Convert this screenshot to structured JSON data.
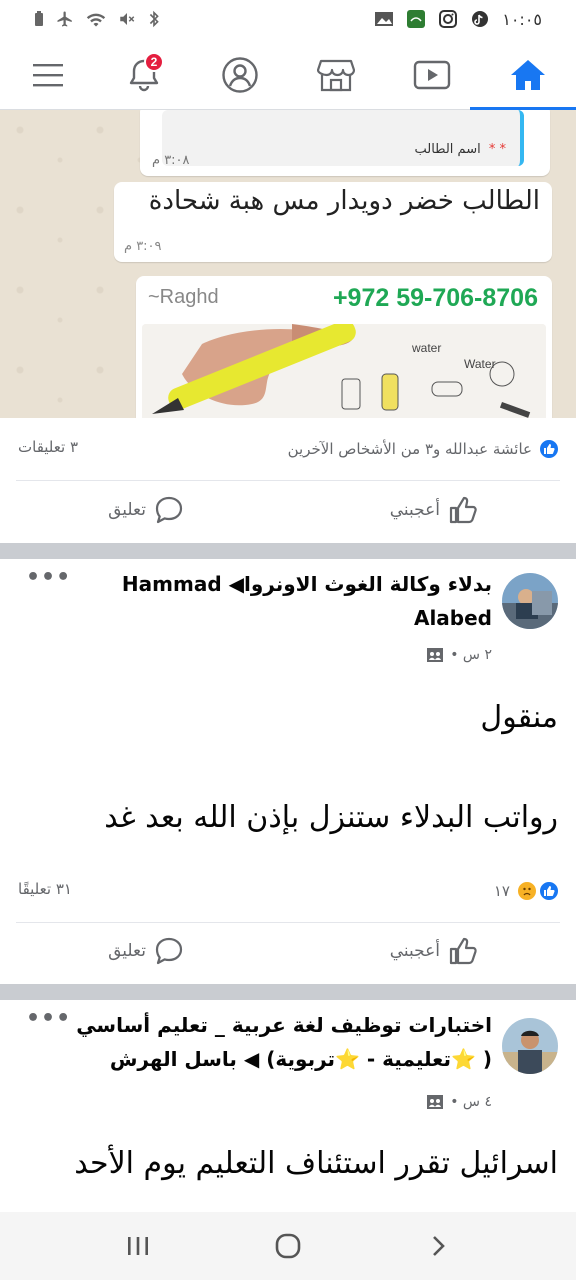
{
  "status_bar": {
    "time": "١٠:٠٥"
  },
  "nav": {
    "items": [
      {
        "name": "menu",
        "icon": "hamburger-menu-icon"
      },
      {
        "name": "notifications",
        "icon": "bell-icon",
        "badge": "2"
      },
      {
        "name": "profile",
        "icon": "profile-icon"
      },
      {
        "name": "marketplace",
        "icon": "store-icon"
      },
      {
        "name": "watch",
        "icon": "video-icon"
      },
      {
        "name": "home",
        "icon": "home-icon",
        "active": true
      }
    ],
    "accent": "#1877f2",
    "badge_color": "#e41e3f"
  },
  "shared_image": {
    "quoted_label": "اسم الطالب",
    "quoted_star": "* *",
    "time_1": "٣:٠٨ م",
    "message": "الطالب خضر دويدار  مس هبة  شحادة",
    "time_2": "٣:٠٩ م",
    "sender": "~Raghd",
    "phone": "+972 59-706-8706"
  },
  "post1": {
    "reactions_text": "عائشة عبدالله و٣ من الأشخاص الآخرين",
    "comments_count": "٣ تعليقات",
    "like_label": "أعجبني",
    "comment_label": "تعليق"
  },
  "post2": {
    "author_line1": "بدلاء وكالة الغوث الاونروا◀ Hammad",
    "author_line2": "Alabed",
    "time": "٢ س •",
    "text_line1": "منقول",
    "text_line2": "رواتب البدلاء ستنزل بإذن الله بعد غد",
    "reactions_count": "١٧",
    "comments_count": "٣١ تعليقًا",
    "like_label": "أعجبني",
    "comment_label": "تعليق"
  },
  "post3": {
    "author_line1": "اختبارات توظيف لغة عربية _ تعليم أساسي",
    "author_line2": "( ⭐تعليمية - ⭐تربوية) ◀ باسل الهرش",
    "time": "٤ س •",
    "text_line1": "اسرائيل تقرر استئناف التعليم يوم الأحد"
  }
}
